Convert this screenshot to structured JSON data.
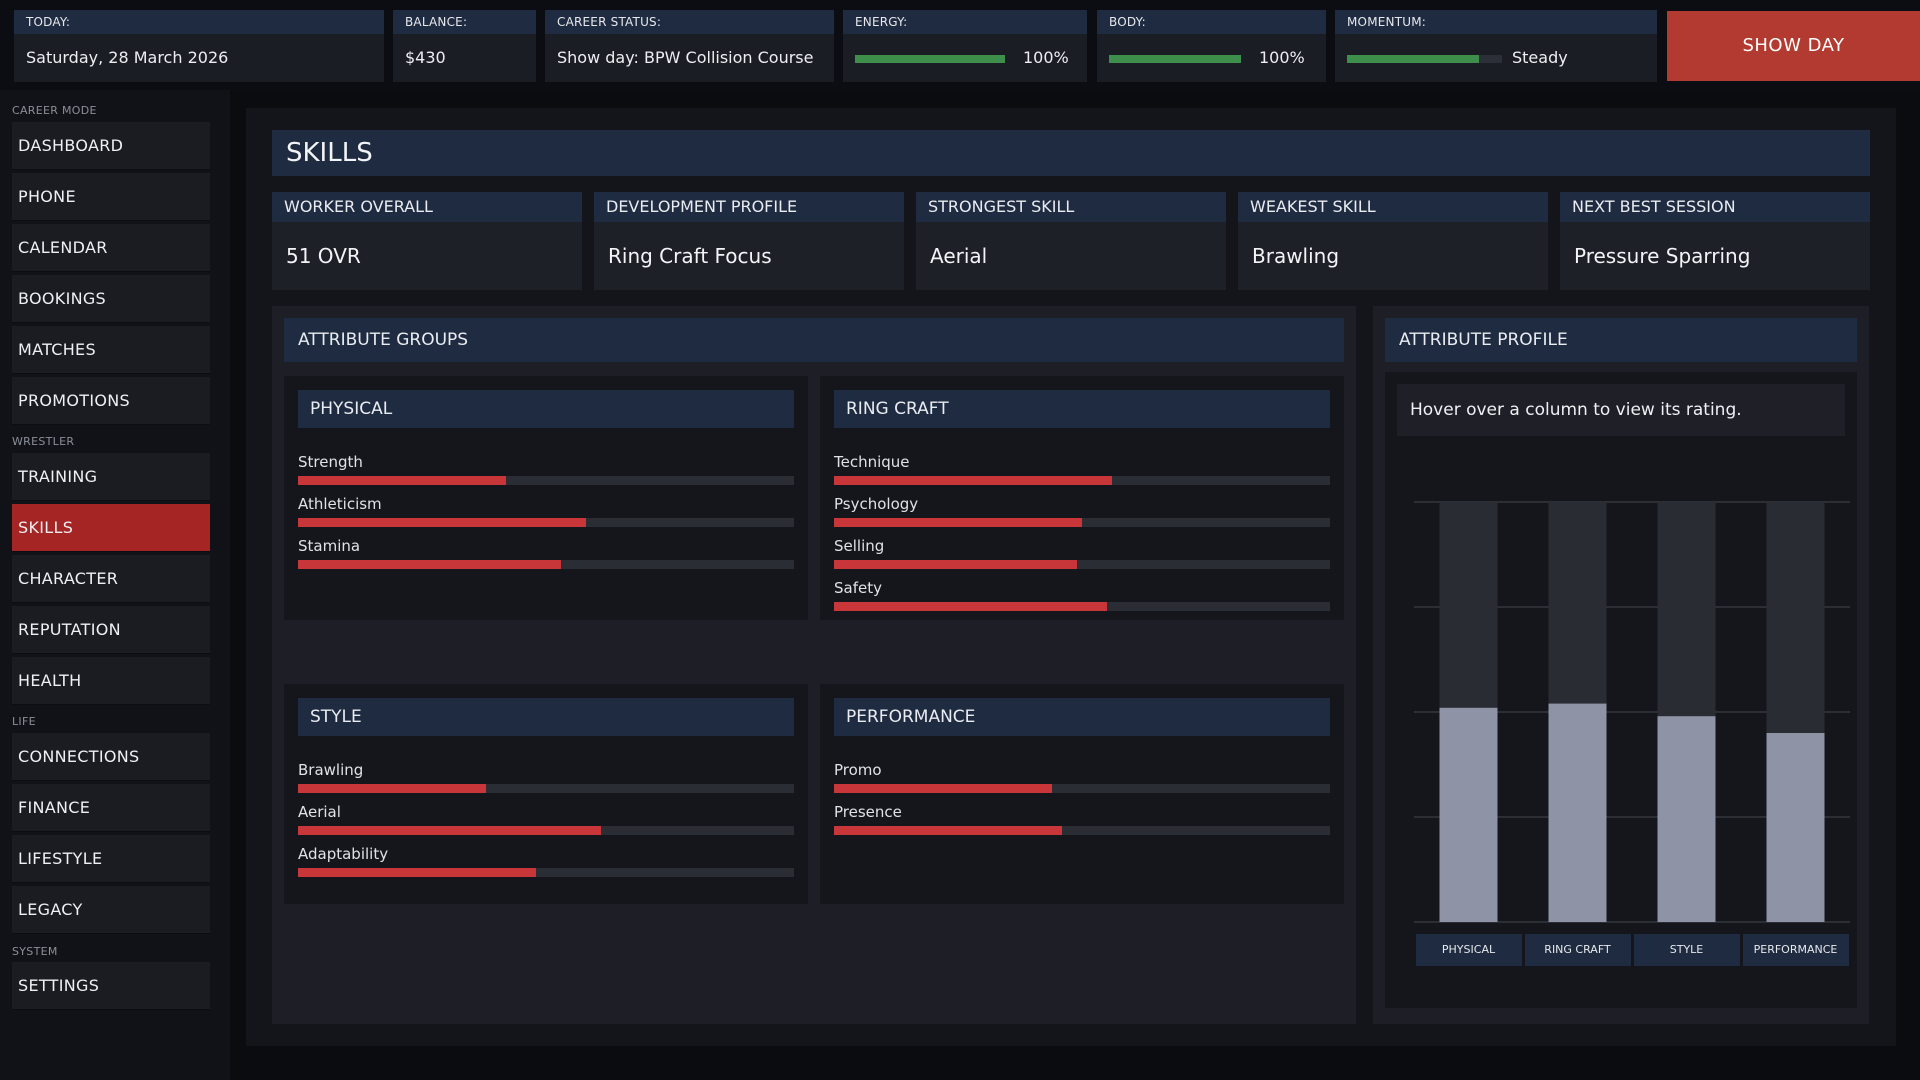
{
  "topbar": {
    "today_label": "TODAY:",
    "today_value": "Saturday, 28 March 2026",
    "balance_label": "BALANCE:",
    "balance_value": "$430",
    "career_label": "CAREER STATUS:",
    "career_value": "Show day: BPW Collision Course",
    "energy_label": "ENERGY:",
    "energy_value": "100%",
    "energy_level": 1.0,
    "body_label": "BODY:",
    "body_value": "100%",
    "body_level": 1.0,
    "momentum_label": "MOMENTUM:",
    "momentum_value": "Steady",
    "momentum_level": 0.85,
    "meter_color": "#3f8f4c",
    "show_day_button": "SHOW DAY"
  },
  "sidebar": {
    "sections": [
      "CAREER MODE",
      "WRESTLER",
      "LIFE",
      "SYSTEM"
    ],
    "items": [
      {
        "label": "DASHBOARD"
      },
      {
        "label": "PHONE"
      },
      {
        "label": "CALENDAR"
      },
      {
        "label": "BOOKINGS"
      },
      {
        "label": "MATCHES"
      },
      {
        "label": "PROMOTIONS"
      },
      {
        "label": "TRAINING"
      },
      {
        "label": "SKILLS"
      },
      {
        "label": "CHARACTER"
      },
      {
        "label": "REPUTATION"
      },
      {
        "label": "HEALTH"
      },
      {
        "label": "CONNECTIONS"
      },
      {
        "label": "FINANCE"
      },
      {
        "label": "LIFESTYLE"
      },
      {
        "label": "LEGACY"
      },
      {
        "label": "SETTINGS"
      }
    ],
    "active_item": "SKILLS",
    "active_color": "#a52424"
  },
  "page": {
    "title": "SKILLS",
    "cards": [
      {
        "label": "WORKER OVERALL",
        "value": "51 OVR"
      },
      {
        "label": "DEVELOPMENT PROFILE",
        "value": "Ring Craft Focus"
      },
      {
        "label": "STRONGEST SKILL",
        "value": "Aerial"
      },
      {
        "label": "WEAKEST SKILL",
        "value": "Brawling"
      },
      {
        "label": "NEXT BEST SESSION",
        "value": "Pressure Sparring"
      }
    ]
  },
  "attribute_groups": {
    "title": "ATTRIBUTE GROUPS",
    "bar_color": "#c8363a",
    "groups": [
      {
        "name": "PHYSICAL",
        "attributes": [
          {
            "name": "Strength",
            "level": 0.42
          },
          {
            "name": "Athleticism",
            "level": 0.58
          },
          {
            "name": "Stamina",
            "level": 0.53
          }
        ]
      },
      {
        "name": "RING CRAFT",
        "attributes": [
          {
            "name": "Technique",
            "level": 0.56
          },
          {
            "name": "Psychology",
            "level": 0.5
          },
          {
            "name": "Selling",
            "level": 0.49
          },
          {
            "name": "Safety",
            "level": 0.55
          }
        ]
      },
      {
        "name": "STYLE",
        "attributes": [
          {
            "name": "Brawling",
            "level": 0.38
          },
          {
            "name": "Aerial",
            "level": 0.61
          },
          {
            "name": "Adaptability",
            "level": 0.48
          }
        ]
      },
      {
        "name": "PERFORMANCE",
        "attributes": [
          {
            "name": "Promo",
            "level": 0.44
          },
          {
            "name": "Presence",
            "level": 0.46
          }
        ]
      }
    ]
  },
  "attribute_profile": {
    "title": "ATTRIBUTE PROFILE",
    "hint": "Hover over a column to view its rating."
  },
  "chart_data": {
    "type": "bar",
    "categories": [
      "PHYSICAL",
      "RING CRAFT",
      "STYLE",
      "PERFORMANCE"
    ],
    "values": [
      51,
      52,
      49,
      45
    ],
    "ylim": [
      0,
      100
    ],
    "grid": true,
    "bar_color": "#8e93a5",
    "track_color": "#2a2c34"
  }
}
